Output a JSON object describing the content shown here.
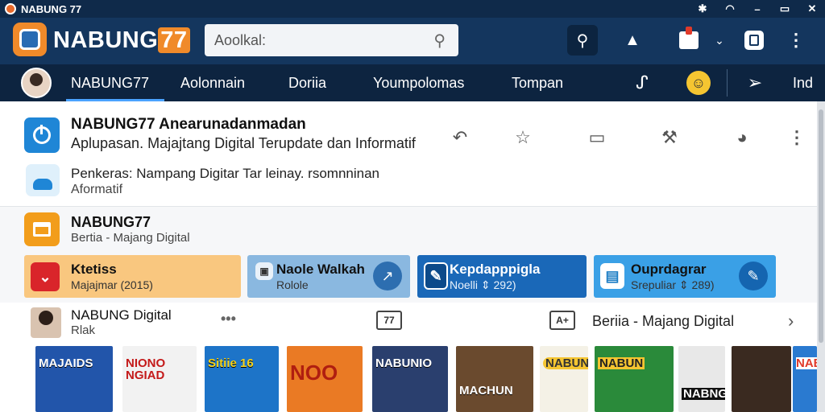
{
  "window": {
    "title": "NABUNG 77"
  },
  "header": {
    "brand_text": "NABUNG",
    "brand_number": "77",
    "search_placeholder": "Aoolkal:"
  },
  "nav": {
    "items": [
      {
        "label": "NABUNG77",
        "active": true
      },
      {
        "label": "Aolonnain"
      },
      {
        "label": "Doriia"
      },
      {
        "label": "Youmpolomas"
      },
      {
        "label": "Tompan"
      },
      {
        "label": "Ind"
      }
    ]
  },
  "feed": {
    "primary": {
      "title": "NABUNG77 Anearunadanmadan",
      "subtitle": "Aplupasan. Majajtang Digital Terupdate dan Informatif"
    },
    "secondary": {
      "title": "Penkeras: Nampang Digitar Tar leinay. rsomnninan",
      "subtitle": "Aformatif"
    },
    "section": {
      "title": "NABUNG77",
      "subtitle": "Bertia - Majang Digital"
    }
  },
  "cards": [
    {
      "title": "Ktetiss",
      "subtitle": "Majajmar (2015)",
      "bg": "#f9c77f",
      "icon_bg": "#d9252a"
    },
    {
      "title": "Naole Walkah",
      "subtitle": "Rolole",
      "bg": "#8ab8e0",
      "icon_bg": "#5a8fc4"
    },
    {
      "title": "Kepdapppigla",
      "subtitle": "Noelli ⇕ 292)",
      "bg": "#1a68b8",
      "icon_bg": "#0c4a8a"
    },
    {
      "title": "Ouprdagrar",
      "subtitle": "Srepuliar ⇕ 289)",
      "bg": "#3aa0e6",
      "icon_bg": "#1a7cc4"
    }
  ],
  "bottom": {
    "title": "NABUNG Digital",
    "subtitle": "Rlak",
    "box1": "77",
    "box2": "A+",
    "right_title": "Beriia - Majang Digital"
  },
  "thumbnails": [
    {
      "caption": "MAJAIDS",
      "color": "#2255aa"
    },
    {
      "caption": "NIONO NGIAD",
      "color": "#f2f2f2"
    },
    {
      "caption": "Sitiie 16",
      "color": "#1d74c8"
    },
    {
      "caption": "NOO",
      "color": "#ea7a24"
    },
    {
      "caption": "NABUNIO",
      "color": "#2a3f6e"
    },
    {
      "caption": "MACHUN",
      "color": "#6a4a2e"
    },
    {
      "caption": "NABUNG",
      "color": "#f4f1e6"
    },
    {
      "caption": "NABUN",
      "color": "#2a8a3a"
    },
    {
      "caption": "NABNG",
      "color": "#e8e8e8"
    },
    {
      "caption": "",
      "color": "#3a2a20"
    },
    {
      "caption": "NAB",
      "color": "#2a7ad0"
    }
  ]
}
